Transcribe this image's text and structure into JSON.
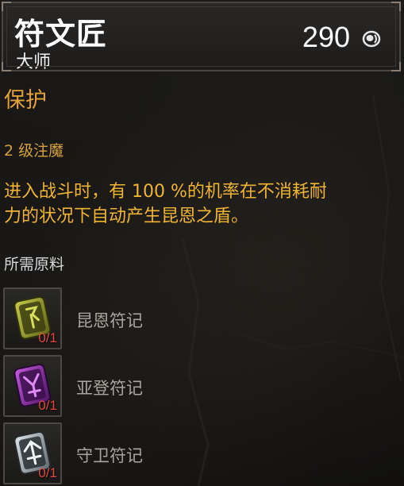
{
  "header": {
    "title": "符文匠",
    "subtitle": "大师",
    "cost": "290",
    "cost_icon": "gold-coin-icon"
  },
  "upgrade": {
    "name": "保护",
    "level": "2 级注魔",
    "description_line1": "进入战斗时，有 100 %的机率在不消耗耐",
    "description_line2": "力的状况下自动产生昆恩之盾。"
  },
  "materials": {
    "title": "所需原料",
    "items": [
      {
        "name": "昆恩符记",
        "count": "0/1",
        "icon": "quen-rune-icon",
        "color": "#9aa02a"
      },
      {
        "name": "亚登符记",
        "count": "0/1",
        "icon": "yrden-rune-icon",
        "color": "#8a2fa8"
      },
      {
        "name": "守卫符记",
        "count": "0/1",
        "icon": "guard-rune-icon",
        "color": "#b9c2c8"
      }
    ]
  },
  "colors": {
    "section_title": "#e3a336",
    "description": "#f0b532",
    "count_missing": "#e24a3a"
  }
}
